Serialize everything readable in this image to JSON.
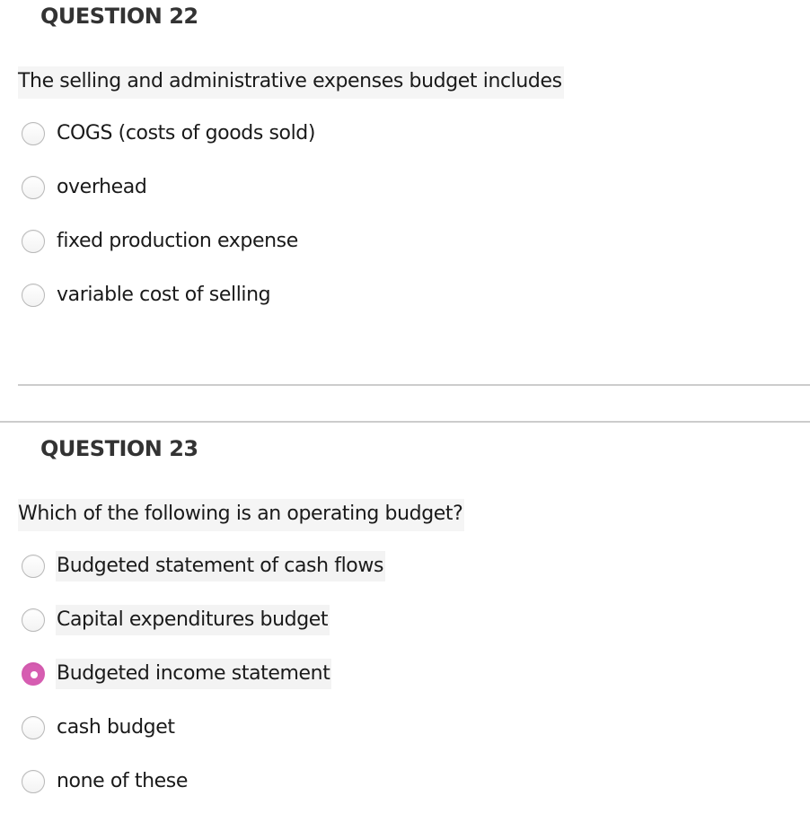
{
  "questions": [
    {
      "title": "QUESTION 22",
      "text": "The selling and administrative expenses budget includes",
      "options": [
        {
          "label": "COGS (costs of goods sold)",
          "selected": false
        },
        {
          "label": "overhead",
          "selected": false
        },
        {
          "label": "fixed production expense",
          "selected": false
        },
        {
          "label": "variable cost of selling",
          "selected": false
        }
      ]
    },
    {
      "title": "QUESTION 23",
      "text": "Which of the following is an operating budget?",
      "options": [
        {
          "label": "Budgeted statement of cash flows",
          "selected": false
        },
        {
          "label": "Capital expenditures budget",
          "selected": false
        },
        {
          "label": "Budgeted income statement",
          "selected": true
        },
        {
          "label": "cash budget",
          "selected": false
        },
        {
          "label": "none of these",
          "selected": false
        }
      ]
    }
  ],
  "colors": {
    "selected_radio": "#d65db1",
    "highlight": "#f4f4f4",
    "divider": "#cccccc"
  }
}
